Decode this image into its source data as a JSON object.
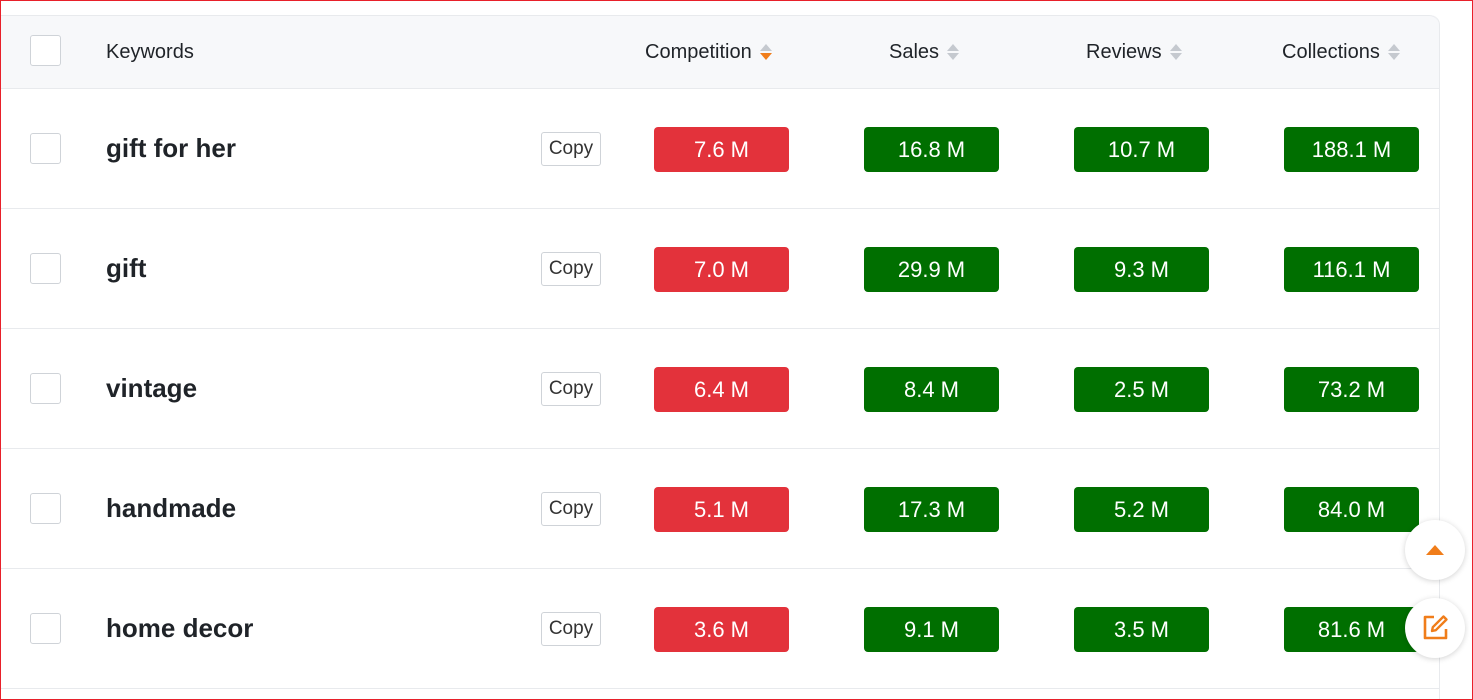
{
  "header": {
    "keywords": "Keywords",
    "competition": "Competition",
    "sales": "Sales",
    "reviews": "Reviews",
    "collections": "Collections"
  },
  "copy_label": "Copy",
  "rows": [
    {
      "keyword": "gift for her",
      "competition": "7.6 M",
      "sales": "16.8 M",
      "reviews": "10.7 M",
      "collections": "188.1 M"
    },
    {
      "keyword": "gift",
      "competition": "7.0 M",
      "sales": "29.9 M",
      "reviews": "9.3 M",
      "collections": "116.1 M"
    },
    {
      "keyword": "vintage",
      "competition": "6.4 M",
      "sales": "8.4 M",
      "reviews": "2.5 M",
      "collections": "73.2 M"
    },
    {
      "keyword": "handmade",
      "competition": "5.1 M",
      "sales": "17.3 M",
      "reviews": "5.2 M",
      "collections": "84.0 M"
    },
    {
      "keyword": "home decor",
      "competition": "3.6 M",
      "sales": "9.1 M",
      "reviews": "3.5 M",
      "collections": "81.6 M"
    }
  ],
  "colors": {
    "competition_badge": "#e3323b",
    "metric_badge": "#006f00",
    "accent": "#f07d1a"
  },
  "icons": {
    "scroll_top": "caret-up-icon",
    "feedback": "edit-icon"
  }
}
